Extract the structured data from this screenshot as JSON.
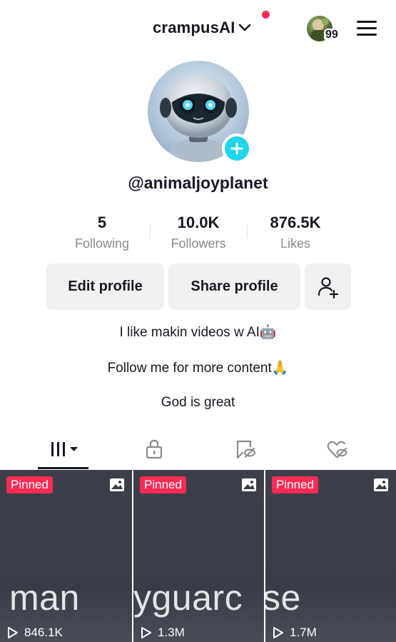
{
  "header": {
    "account_name": "crampusAI",
    "notification_badge": "99"
  },
  "profile": {
    "username": "@animaljoyplanet",
    "stats": [
      {
        "value": "5",
        "label": "Following"
      },
      {
        "value": "10.0K",
        "label": "Followers"
      },
      {
        "value": "876.5K",
        "label": "Likes"
      }
    ],
    "buttons": {
      "edit": "Edit profile",
      "share": "Share profile"
    },
    "bio": [
      "I like makin videos w AI🤖",
      "Follow me for more content🙏",
      "God is great"
    ]
  },
  "tabs": [
    {
      "icon": "grid-videos-icon",
      "active": true
    },
    {
      "icon": "lock-icon",
      "active": false
    },
    {
      "icon": "bookmark-icon",
      "active": false
    },
    {
      "icon": "liked-heart-icon",
      "active": false
    }
  ],
  "videos": [
    {
      "pinned_label": "Pinned",
      "overlay_text": "man",
      "views": "846.1K"
    },
    {
      "pinned_label": "Pinned",
      "overlay_text": "yguarc",
      "views": "1.3M"
    },
    {
      "pinned_label": "Pinned",
      "overlay_text": "se",
      "views": "1.7M"
    }
  ],
  "colors": {
    "accent": "#fe2c55",
    "add_button": "#20d5ec",
    "secondary_text": "#8a8b91",
    "button_bg": "#f1f1f2"
  }
}
